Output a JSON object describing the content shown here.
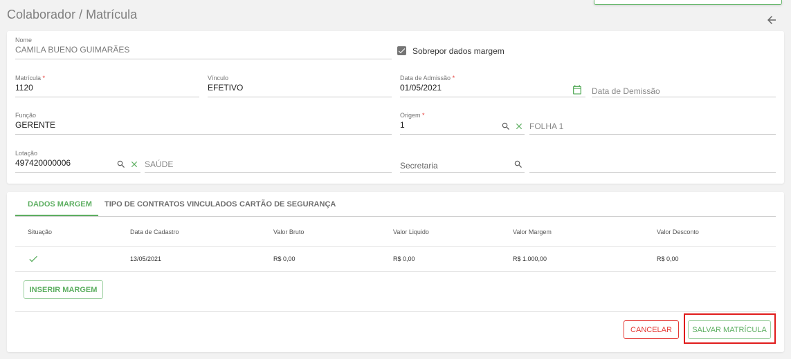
{
  "header": {
    "title": "Colaborador / Matrícula"
  },
  "form": {
    "nome": {
      "label": "Nome",
      "value": "CAMILA BUENO GUIMARÃES"
    },
    "sobrepor": {
      "label": "Sobrepor dados margem",
      "checked": true
    },
    "matricula": {
      "label": "Matrícula",
      "required_mark": "*",
      "value": "1120"
    },
    "vinculo": {
      "label": "Vínculo",
      "value": "EFETIVO"
    },
    "admissao": {
      "label": "Data de Admissão",
      "required_mark": "*",
      "value": "01/05/2021"
    },
    "demissao": {
      "placeholder": "Data de Demissão"
    },
    "funcao": {
      "label": "Função",
      "value": "GERENTE"
    },
    "origem": {
      "label": "Origem",
      "required_mark": "*",
      "value": "1",
      "description": "FOLHA 1"
    },
    "lotacao": {
      "label": "Lotação",
      "value": "497420000006",
      "description": "SAÚDE"
    },
    "secretaria": {
      "placeholder": "Secretaria"
    }
  },
  "tabs": [
    {
      "label": "DADOS MARGEM",
      "active": true
    },
    {
      "label": "TIPO DE CONTRATOS VINCULADOS",
      "active": false
    },
    {
      "label": "CARTÃO DE SEGURANÇA",
      "active": false
    }
  ],
  "table": {
    "headers": [
      "Situação",
      "Data de Cadastro",
      "Valor Bruto",
      "Valor Liquido",
      "Valor Margem",
      "Valor Desconto"
    ],
    "rows": [
      {
        "situacao_icon": "check-icon",
        "data_cadastro": "13/05/2021",
        "valor_bruto": "R$ 0,00",
        "valor_liquido": "R$ 0,00",
        "valor_margem": "R$ 1.000,00",
        "valor_desconto": "R$ 0,00"
      }
    ]
  },
  "actions": {
    "insert_label": "INSERIR MARGEM",
    "cancel_label": "CANCELAR",
    "save_label": "SALVAR MATRÍCULA"
  },
  "colors": {
    "accent": "#5cae60",
    "danger": "#e53935",
    "highlight": "#e01b1b"
  }
}
